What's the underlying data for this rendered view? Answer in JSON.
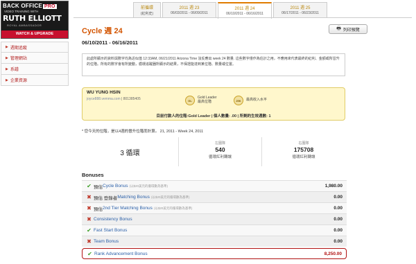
{
  "promo": {
    "brand": "BACK OFFICE",
    "brand_pro": "PRO",
    "tagline": "VIDEO TRAINING WITH",
    "person": "RUTH ELLIOTT",
    "role": "ROYAL AMBASSADOR",
    "cta": "WATCH & UPGRADE"
  },
  "nav": {
    "items": [
      {
        "label": "週期追蹤"
      },
      {
        "label": "管理網站"
      },
      {
        "label": "系譜"
      },
      {
        "label": "企業資源"
      }
    ]
  },
  "tabs": [
    {
      "line1": "前循環",
      "line2": "(紅利史)"
    },
    {
      "line1": "2011 週 23",
      "line2": "06/03/2011 - 06/09/2011"
    },
    {
      "line1": "2011 週 24",
      "line2": "06/10/2011 - 06/16/2011"
    },
    {
      "line1": "2011 週 25",
      "line2": "06/17/2011 - 06/23/2011"
    }
  ],
  "header": {
    "title": "Cycle 週 24",
    "print_label": "列印預覽",
    "date_range": "06/10/2011 - 06/16/2011"
  },
  "notice": "此處所顯示的資料與數字均為近似值 12:33AM, 06/21/2011 Arizona Time 沒反應出 week 24 數量. 這些數字僅作為估計之用，不應用來代表最終的紅利、金額或所晉升的位階。所有的數字會有所變動，循環追蹤器所顯示的結果，不保證能達到某位階、數量或位置。",
  "member": {
    "name": "WU YUNG HSIN",
    "email": "joyce888.vemma.com",
    "id": "801385405",
    "rank_badge": "GL",
    "rank_label": "Gold Leader",
    "rank_sub": "最高位階",
    "income_badge": "25K",
    "income_label": "最高收入水平",
    "position_prefix": "目前付款人的位階:",
    "position_value": "Gold Leader",
    "position_mid": "| 個人數量: .00 | 所剩的生效週數: 1"
  },
  "note": "* 您今天的位階，是以4週的晉升位階而計算。 21, 2011 - Week 24, 2011",
  "stats": {
    "cycles": "3 循環",
    "left_label": "左圍隊",
    "left_value": "540",
    "left_sub": "循環紅利轉讓",
    "right_label": "右圍隊",
    "right_value": "175708",
    "right_sub": "循環紅利轉讓"
  },
  "bonuses": {
    "heading": "Bonuses",
    "rows": [
      {
        "status": "ok",
        "prefix": "預估 ",
        "name": "Cycle Bonus",
        "note": "(以$20美元的循環數為基準)",
        "amount": "1,980.00"
      },
      {
        "status": "no",
        "prefix": "預估 登錄者 ",
        "name": "Matching Bonus",
        "note": "(以$20美元的循環數為基準)",
        "amount": "0.00"
      },
      {
        "status": "no",
        "prefix": "預估 ",
        "name": "2nd Tier Matching Bonus",
        "note": "(以$20美元的循環數為基準)",
        "amount": "0.00"
      },
      {
        "status": "no",
        "prefix": "",
        "name": "Consistency Bonus",
        "note": "",
        "amount": "0.00"
      },
      {
        "status": "ok",
        "prefix": "",
        "name": "Fast Start Bonus",
        "note": "",
        "amount": "0.00"
      },
      {
        "status": "no",
        "prefix": "",
        "name": "Team Bonus",
        "note": "",
        "amount": "0.00"
      },
      {
        "status": "ok",
        "prefix": "",
        "name": "Rank Advancement Bonus",
        "note": "",
        "amount": "8,250.00"
      }
    ]
  }
}
